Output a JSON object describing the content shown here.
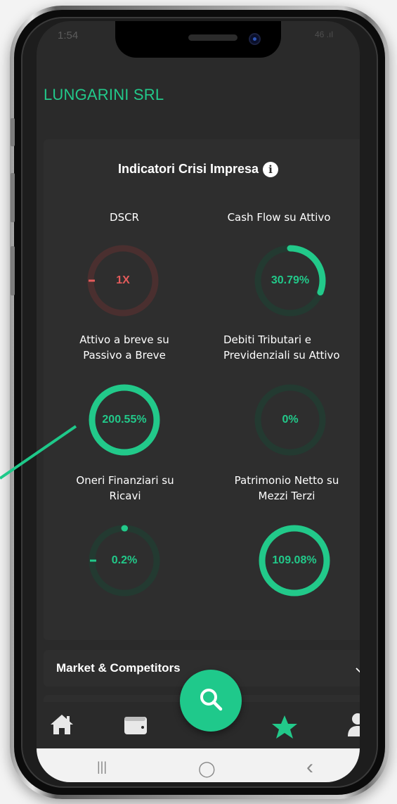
{
  "status_bar": {
    "time": "1:54",
    "right": "46 .ıl"
  },
  "company_name": "LUNGARINI SRL",
  "section": {
    "title": "Indicatori Crisi Impresa",
    "info_glyph": "i"
  },
  "indicators": [
    {
      "label": "DSCR",
      "value": "1X",
      "progress": 0,
      "negative": true
    },
    {
      "label": "Cash Flow su Attivo",
      "value": "30.79%",
      "progress": 0.3079
    },
    {
      "label": "Attivo a breve su Passivo a Breve",
      "value": "200.55%",
      "progress": 1.0
    },
    {
      "label": "Debiti Tributari e Previdenziali su Attivo",
      "value": "0%",
      "progress": 0
    },
    {
      "label": "Oneri Finanziari su Ricavi",
      "value": "0.2%",
      "progress": 0.002
    },
    {
      "label": "Patrimonio Netto su Mezzi Terzi",
      "value": "109.08%",
      "progress": 1.0
    }
  ],
  "accordions": [
    {
      "label": "Market & Competitors",
      "chevron": "chevron-down-icon"
    }
  ],
  "tabs": [
    {
      "name": "home-icon"
    },
    {
      "name": "wallet-icon"
    },
    {
      "name": "search-icon"
    },
    {
      "name": "star-icon",
      "active": true
    },
    {
      "name": "user-icon"
    }
  ],
  "colors": {
    "accent": "#22c98a",
    "ring_track": "#233a31",
    "negative": "#e35b5b",
    "negative_track": "#4a2f2f",
    "screen_bg": "#2a2a2a",
    "card_bg": "#2e2e2e"
  },
  "system_nav": {
    "recents": "|||",
    "home": "◯",
    "back": "‹"
  }
}
